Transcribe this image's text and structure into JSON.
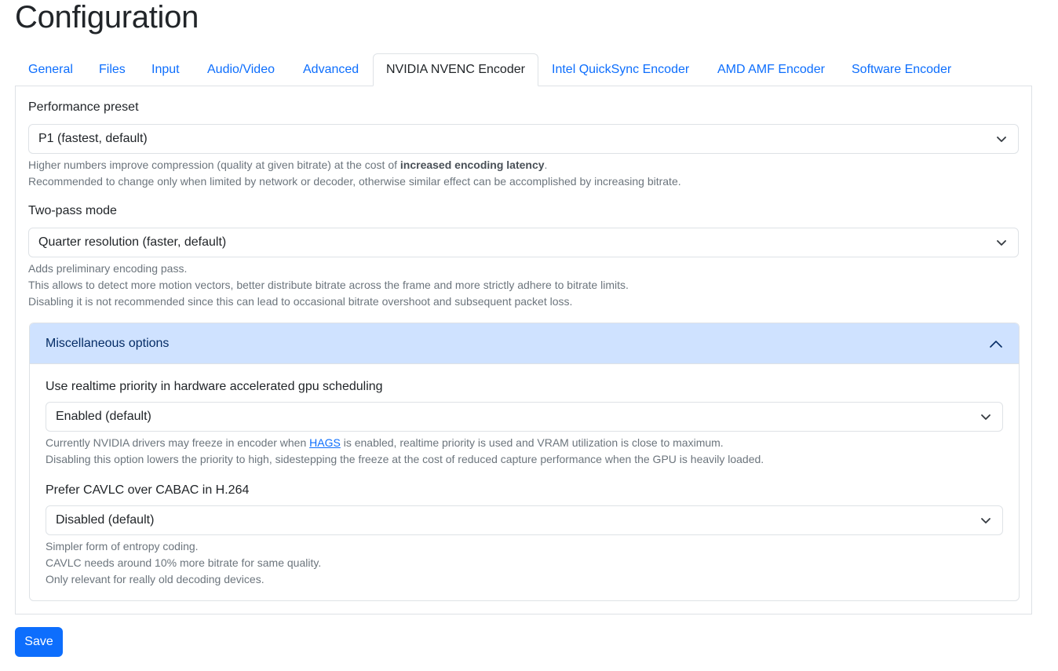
{
  "page": {
    "title": "Configuration"
  },
  "tabs": [
    {
      "label": "General"
    },
    {
      "label": "Files"
    },
    {
      "label": "Input"
    },
    {
      "label": "Audio/Video"
    },
    {
      "label": "Advanced"
    },
    {
      "label": "NVIDIA NVENC Encoder",
      "active": true
    },
    {
      "label": "Intel QuickSync Encoder"
    },
    {
      "label": "AMD AMF Encoder"
    },
    {
      "label": "Software Encoder"
    }
  ],
  "performance_preset": {
    "label": "Performance preset",
    "value": "P1 (fastest, default)",
    "help_prefix": "Higher numbers improve compression (quality at given bitrate) at the cost of ",
    "help_bold": "increased encoding latency",
    "help_suffix": ".",
    "help_line2": "Recommended to change only when limited by network or decoder, otherwise similar effect can be accomplished by increasing bitrate."
  },
  "two_pass": {
    "label": "Two-pass mode",
    "value": "Quarter resolution (faster, default)",
    "help": [
      "Adds preliminary encoding pass.",
      "This allows to detect more motion vectors, better distribute bitrate across the frame and more strictly adhere to bitrate limits.",
      "Disabling it is not recommended since this can lead to occasional bitrate overshoot and subsequent packet loss."
    ]
  },
  "misc": {
    "title": "Miscellaneous options",
    "realtime": {
      "label": "Use realtime priority in hardware accelerated gpu scheduling",
      "value": "Enabled (default)",
      "help_prefix": "Currently NVIDIA drivers may freeze in encoder when ",
      "help_link": "HAGS",
      "help_suffix": " is enabled, realtime priority is used and VRAM utilization is close to maximum.",
      "help_line2": "Disabling this option lowers the priority to high, sidestepping the freeze at the cost of reduced capture performance when the GPU is heavily loaded."
    },
    "cavlc": {
      "label": "Prefer CAVLC over CABAC in H.264",
      "value": "Disabled (default)",
      "help": [
        "Simpler form of entropy coding.",
        "CAVLC needs around 10% more bitrate for same quality.",
        "Only relevant for really old decoding devices."
      ]
    }
  },
  "save_label": "Save",
  "colors": {
    "accent": "#0d6efd",
    "accordion_header": "#cfe2ff"
  }
}
